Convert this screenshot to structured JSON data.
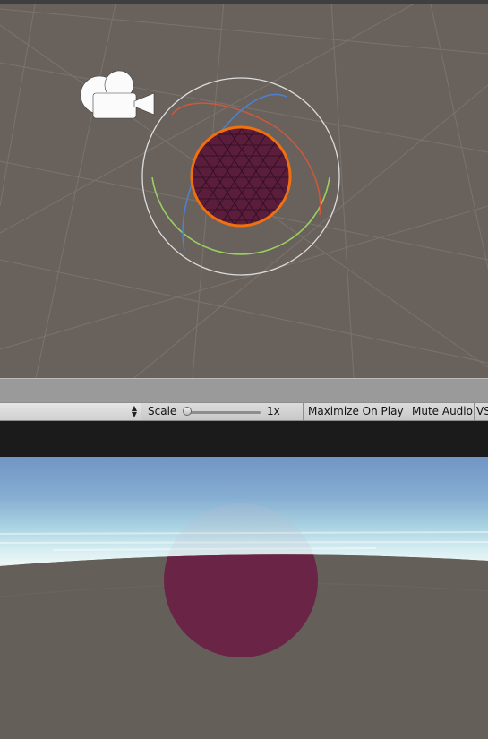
{
  "game_toolbar": {
    "scale_label": "Scale",
    "scale_value": "1x",
    "maximize_label": "Maximize On Play",
    "mute_label": "Mute Audio",
    "stats_label": "VS"
  },
  "icons": {
    "camera": "camera-gizmo-icon",
    "dropdown": "up-down-arrows-icon"
  },
  "colors": {
    "scene_background": "#69625c",
    "grid_lines": "#7d7771",
    "sphere_fill": "#5a1d3c",
    "selection_outline": "#f07010",
    "rotate_x_axis": "#d0573a",
    "rotate_y_axis": "#9ad060",
    "rotate_z_axis": "#4f7fd0",
    "sky_top": "#7a9bc4",
    "horizon": "#cfe8ee",
    "ground": "#655f59",
    "game_sphere": "#6a2546"
  }
}
